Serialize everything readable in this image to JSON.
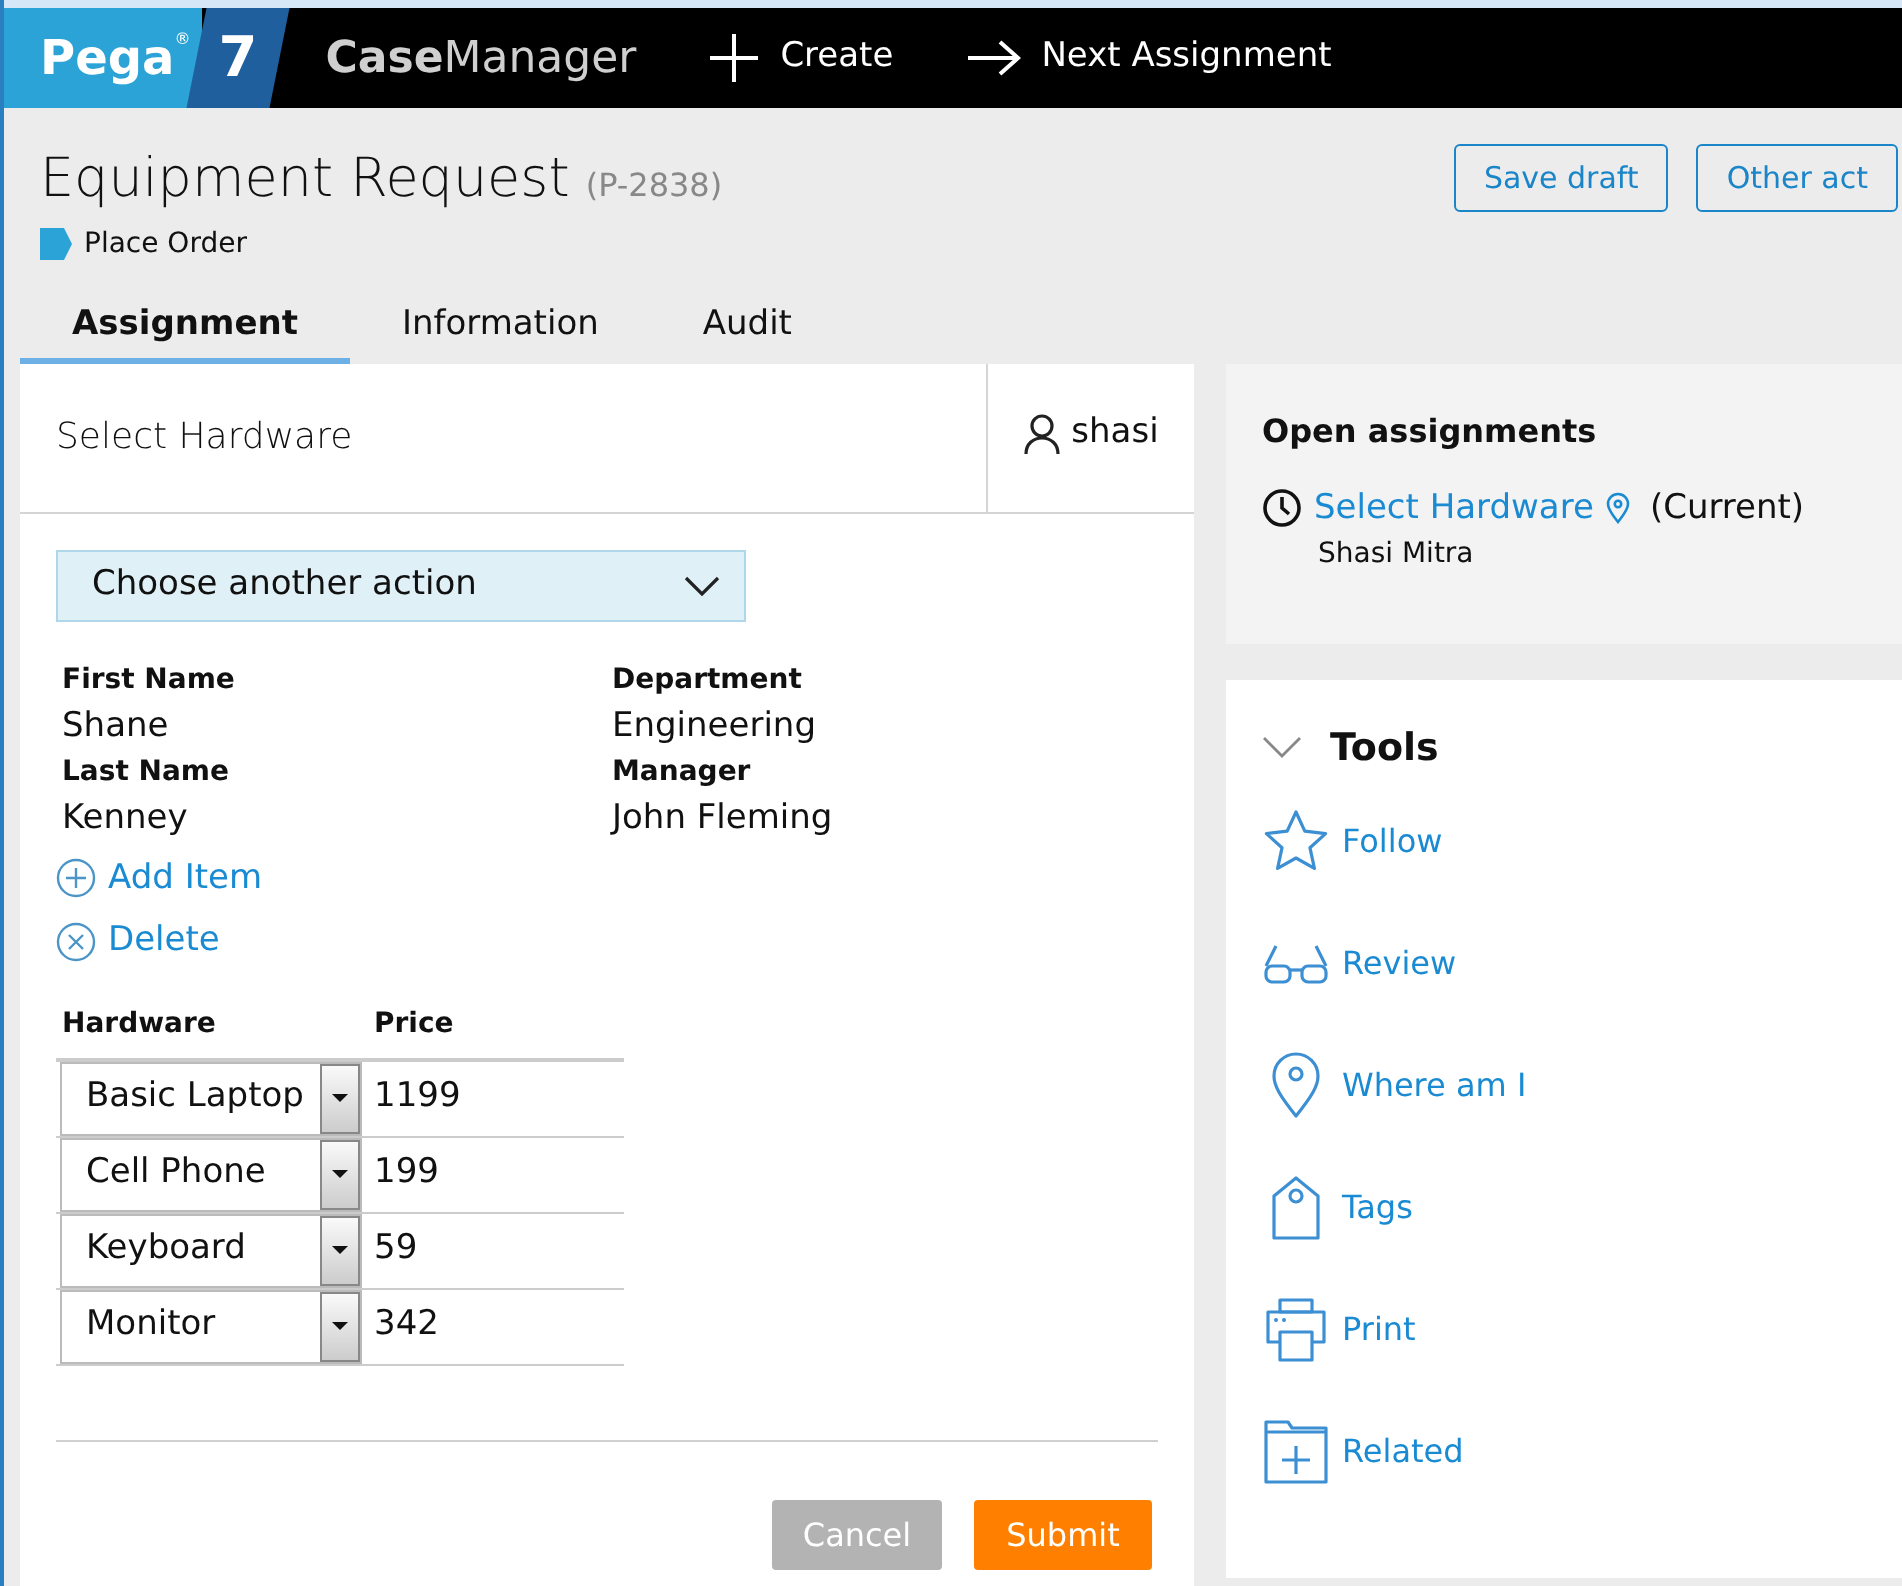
{
  "topbar": {
    "logo": "Pega",
    "logo_mark": "®",
    "version": "7",
    "app_name": "**Case**Manager",
    "actions": [
      {
        "kind": "create",
        "label": "Create"
      },
      {
        "kind": "next",
        "label": "Next Assignment"
      }
    ]
  },
  "case": {
    "title": "Equipment Request",
    "id": "(P-2838)",
    "stage": "Place Order",
    "buttons": [
      "Save draft",
      "Other act"
    ]
  },
  "tabs": [
    {
      "label": "Assignment",
      "selected": true
    },
    {
      "label": "Information",
      "selected": false
    },
    {
      "label": "Audit",
      "selected": false
    }
  ],
  "assignment": {
    "title": "Select Hardware",
    "user": "shasi",
    "action_menu": "Choose another action",
    "fields": [
      {
        "label": "First Name",
        "value": "Shane"
      },
      {
        "label": "Department",
        "value": "Engineering"
      },
      {
        "label": "Last Name",
        "value": "Kenney"
      },
      {
        "label": "Manager",
        "value": "John Fleming"
      }
    ],
    "links": [
      {
        "kind": "add",
        "label": "Add Item"
      },
      {
        "kind": "delete",
        "label": "Delete"
      }
    ],
    "table": {
      "columns": [
        "Hardware",
        "Price"
      ],
      "rows": [
        {
          "hardware": "Basic Laptop",
          "price": "1199"
        },
        {
          "hardware": "Cell Phone",
          "price": "199"
        },
        {
          "hardware": "Keyboard",
          "price": "59"
        },
        {
          "hardware": "Monitor",
          "price": "342"
        }
      ]
    },
    "cancel": "Cancel",
    "submit": "Submit"
  },
  "open_assignments": {
    "title": "Open assignments",
    "items": [
      {
        "name": "Select Hardware",
        "status": "(Current)",
        "assignee": "Shasi Mitra"
      }
    ]
  },
  "tools": {
    "title": "Tools",
    "expanded": true,
    "items": [
      {
        "kind": "follow",
        "label": "Follow"
      },
      {
        "kind": "review",
        "label": "Review"
      },
      {
        "kind": "where",
        "label": "Where am I"
      },
      {
        "kind": "tags",
        "label": "Tags"
      },
      {
        "kind": "print",
        "label": "Print"
      },
      {
        "kind": "related",
        "label": "Related"
      }
    ]
  }
}
